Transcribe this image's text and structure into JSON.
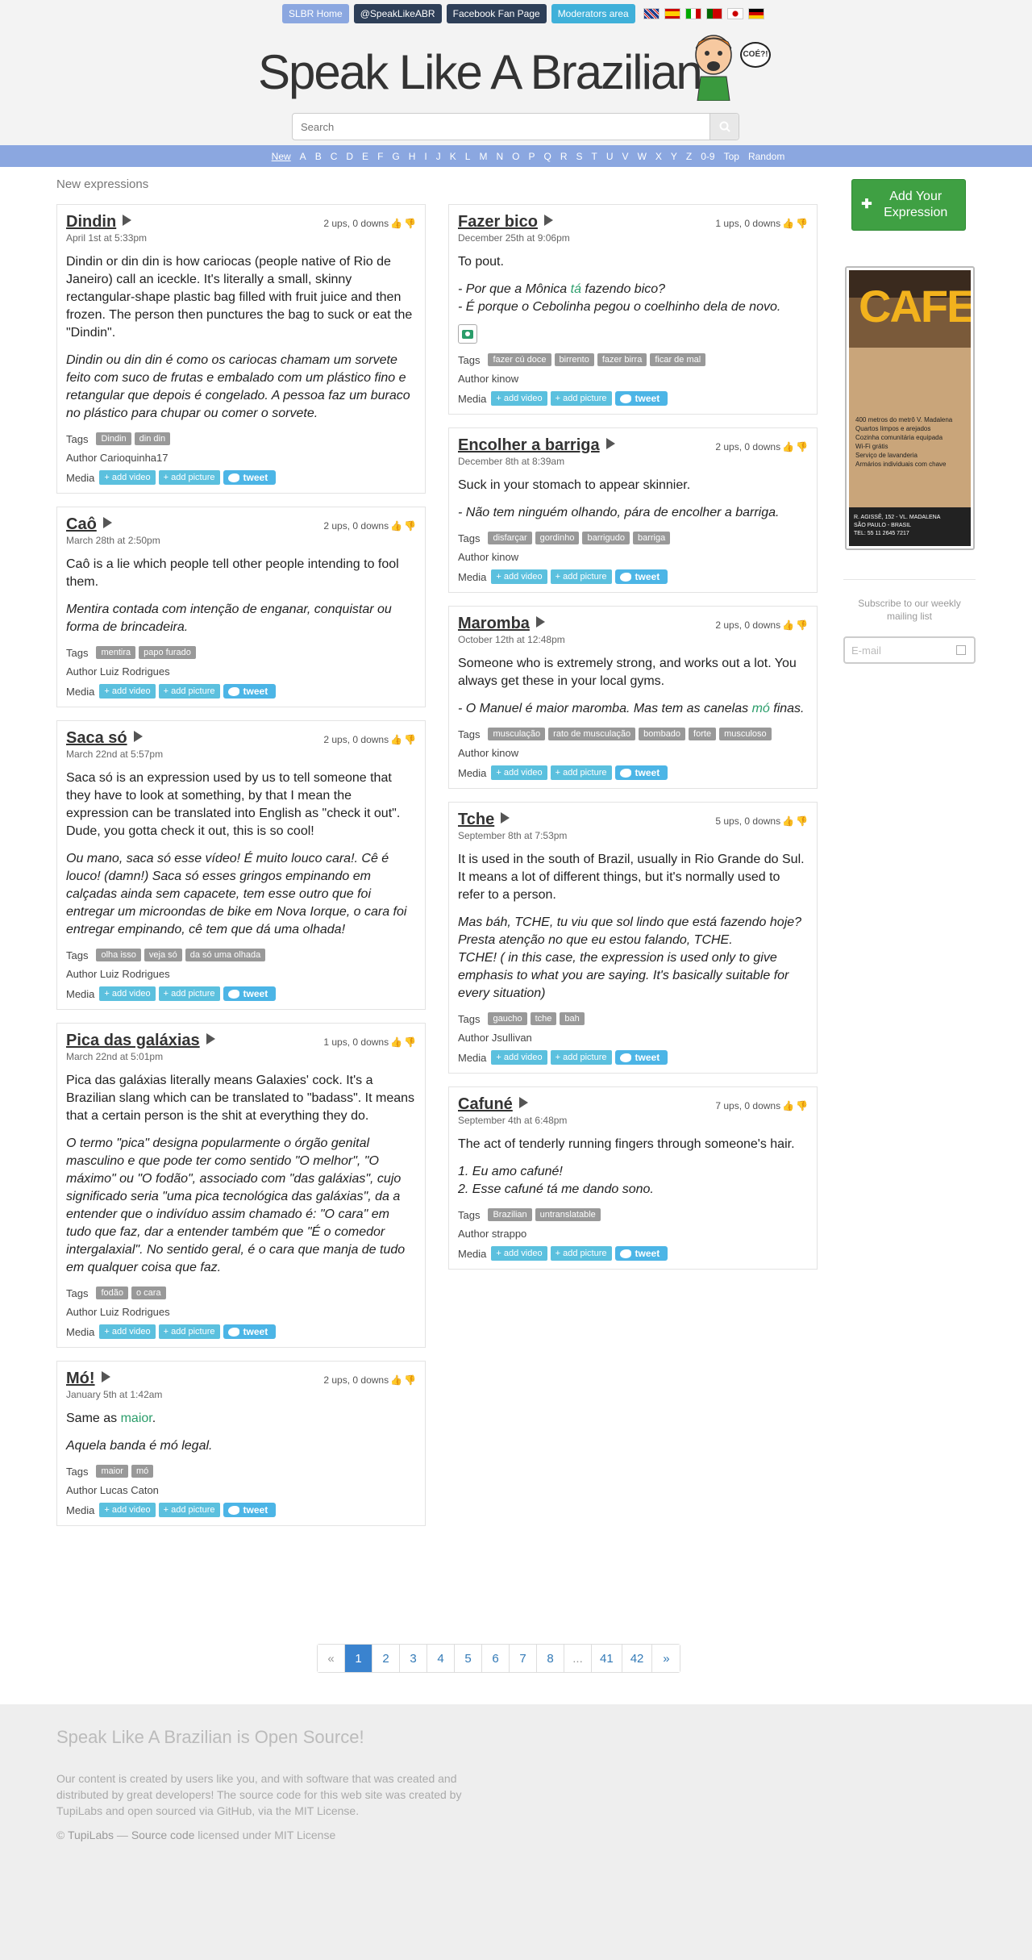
{
  "topnav": {
    "home": "SLBR Home",
    "twitter": "@SpeakLikeABR",
    "facebook": "Facebook Fan Page",
    "moderators": "Moderators area"
  },
  "site_title": "Speak Like A Brazilian",
  "mascot_bubble": "COÉ?!",
  "search": {
    "placeholder": "Search"
  },
  "alphabet": [
    "New",
    "A",
    "B",
    "C",
    "D",
    "E",
    "F",
    "G",
    "H",
    "I",
    "J",
    "K",
    "L",
    "M",
    "N",
    "O",
    "P",
    "Q",
    "R",
    "S",
    "T",
    "U",
    "V",
    "W",
    "X",
    "Y",
    "Z",
    "0-9",
    "Top",
    "Random"
  ],
  "section_title": "New expressions",
  "labels": {
    "tags": "Tags",
    "author_prefix": "Author ",
    "media": "Media",
    "add_video": "+ add video",
    "add_picture": "+ add picture",
    "tweet": "tweet"
  },
  "left_column": [
    {
      "title": "Dindin",
      "date": "April 1st at 5:33pm",
      "votes": "2 ups, 0 downs",
      "meaning": "Dindin or din din is how cariocas (people native of Rio de Janeiro) call an iceckle. It's literally a small, skinny rectangular-shape plastic bag filled with fruit juice and then frozen. The person then punctures the bag to suck or eat the \"Dindin\".",
      "example": "Dindin ou din din é como os cariocas chamam um sorvete feito com suco de frutas e embalado com um plástico fino e retangular que depois é congelado. A pessoa faz um buraco no plástico para chupar ou comer o sorvete.",
      "tags": [
        "Dindin",
        "din din"
      ],
      "author": "Carioquinha17"
    },
    {
      "title": "Caô",
      "date": "March 28th at 2:50pm",
      "votes": "2 ups, 0 downs",
      "meaning": "Caô is a lie which people tell other people intending to fool them.",
      "example": "Mentira contada com intenção de enganar, conquistar ou forma de brincadeira.",
      "tags": [
        "mentira",
        "papo furado"
      ],
      "author": "Luiz Rodrigues"
    },
    {
      "title": "Saca só",
      "date": "March 22nd at 5:57pm",
      "votes": "2 ups, 0 downs",
      "meaning": "Saca só is an expression used by us to tell someone that they have to look at something, by that I mean the expression can be translated into English as \"check it out\". Dude, you gotta check it out, this is so cool!",
      "example": "Ou mano, saca só esse vídeo! É muito louco cara!. Cê é louco! (damn!) Saca só esses gringos empinando em calçadas ainda sem capacete, tem esse outro que foi entregar um microondas de bike em Nova Iorque, o cara foi entregar empinando, cê tem que dá uma olhada!",
      "tags": [
        "olha isso",
        "veja só",
        "da só uma olhada"
      ],
      "author": "Luiz Rodrigues"
    },
    {
      "title": "Pica das galáxias",
      "date": "March 22nd at 5:01pm",
      "votes": "1 ups, 0 downs",
      "meaning": "Pica das galáxias literally means Galaxies' cock. It's a Brazilian slang which can be translated to \"badass\". It means that a certain person is the shit at everything they do.",
      "example": "O termo \"pica\" designa popularmente o órgão genital masculino e que pode ter como sentido \"O melhor\", \"O máximo\" ou \"O fodão\", associado com \"das galáxias\", cujo significado seria \"uma pica tecnológica das galáxias\", da a entender que o indivíduo assim chamado é: \"O cara\" em tudo que faz, dar a entender também que \"É o comedor intergalaxial\". No sentido geral, é o cara que manja de tudo em qualquer coisa que faz.",
      "tags": [
        "fodão",
        "o cara"
      ],
      "author": "Luiz Rodrigues"
    },
    {
      "title": "Mó!",
      "date": "January 5th at 1:42am",
      "votes": "2 ups, 0 downs",
      "meaning_pre": "Same as ",
      "meaning_link": "maior",
      "meaning_post": ".",
      "example": "Aquela banda é mó legal.",
      "tags": [
        "maior",
        "mó"
      ],
      "author": "Lucas Caton"
    }
  ],
  "right_column": [
    {
      "title": "Fazer bico",
      "date": "December 25th at 9:06pm",
      "votes": "1 ups, 0 downs",
      "meaning": "To pout.",
      "example_pre": "- Por que a Mônica ",
      "example_link": "tá",
      "example_post": " fazendo bico?\n- É porque o Cebolinha pegou o coelhinho dela de novo.",
      "tags": [
        "fazer cú doce",
        "birrento",
        "fazer birra",
        "ficar de mal"
      ],
      "author": "kinow"
    },
    {
      "title": "Encolher a barriga",
      "date": "December 8th at 8:39am",
      "votes": "2 ups, 0 downs",
      "meaning": "Suck in your stomach to appear skinnier.",
      "example": "- Não tem ninguém olhando, pára de encolher a barriga.",
      "tags": [
        "disfarçar",
        "gordinho",
        "barrigudo",
        "barriga"
      ],
      "author": "kinow"
    },
    {
      "title": "Maromba",
      "date": "October 12th at 12:48pm",
      "votes": "2 ups, 0 downs",
      "meaning": "Someone who is extremely strong, and works out a lot. You always get these in your local gyms.",
      "example_pre": "- O Manuel é maior maromba. Mas tem as canelas ",
      "example_link": "mó",
      "example_post": " finas.",
      "tags": [
        "musculação",
        "rato de musculação",
        "bombado",
        "forte",
        "musculoso"
      ],
      "author": "kinow"
    },
    {
      "title": "Tche",
      "date": "September 8th at 7:53pm",
      "votes": "5 ups, 0 downs",
      "meaning": "It is used in the south of Brazil, usually in Rio Grande do Sul.\nIt means a lot of different things, but it's normally used to refer to a person.",
      "example": "Mas báh, TCHE, tu viu que sol lindo que está fazendo hoje?\nPresta atenção no que eu estou falando, TCHE.\nTCHE! ( in this case, the expression is used only to give emphasis to what you are saying. It's basically suitable for every situation)",
      "tags": [
        "gaucho",
        "tche",
        "bah"
      ],
      "author": "Jsullivan"
    },
    {
      "title": "Cafuné",
      "date": "September 4th at 6:48pm",
      "votes": "7 ups, 0 downs",
      "meaning": "The act of tenderly running fingers through someone's hair.",
      "example": "1. Eu amo cafuné!\n2. Esse cafuné tá me dando sono.",
      "tags": [
        "Brazilian",
        "untranslatable"
      ],
      "author": "strappo"
    }
  ],
  "sidebar": {
    "add_button": "Add Your Expression",
    "ad": {
      "logo": "CAFE",
      "text": "400 metros do metrô V. Madalena\nQuartos limpos e arejados\nCozinha comunitária equipada\nWi-Fi grátis\nServiço de lavanderia\nArmários individuais com chave",
      "footer": "R. AGISSÊ, 152 - VL. MADALENA\nSÃO PAULO - BRASIL\nTEL: 55 11 2645 7217"
    },
    "subscribe_text": "Subscribe to our weekly mailing list",
    "email_placeholder": "E-mail"
  },
  "pagination": [
    "«",
    "1",
    "2",
    "3",
    "4",
    "5",
    "6",
    "7",
    "8",
    "...",
    "41",
    "42",
    "»"
  ],
  "pagination_active": "1",
  "footer": {
    "title": "Speak Like A Brazilian is Open Source!",
    "text": "Our content is created by users like you, and with software that was created and distributed by great developers! The source code for this web site was created by TupiLabs and open sourced via GitHub, via the MIT License.",
    "copy_prefix": "© ",
    "tupilabs": "TupiLabs",
    "sep": " — ",
    "source": "Source code",
    "license": " licensed under MIT License"
  },
  "colors": {
    "nav_blue": "#8ba7e0",
    "green": "#3fa043",
    "teal_link": "#2a9d6a",
    "media_button": "#5bc0de"
  }
}
